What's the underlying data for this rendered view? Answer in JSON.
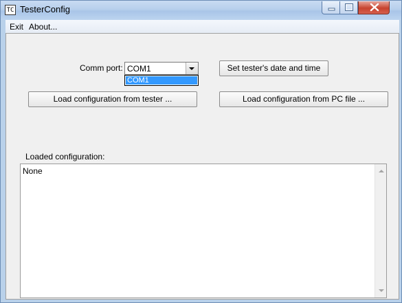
{
  "window": {
    "title": "TesterConfig",
    "icon_text": "TC"
  },
  "menu": {
    "items": [
      {
        "label": "Exit"
      },
      {
        "label": "About..."
      }
    ]
  },
  "form": {
    "comm_port_label": "Comm port:",
    "comm_port_value": "COM1",
    "comm_port_options": [
      "COM1"
    ],
    "set_datetime_button": "Set tester's date and time",
    "load_from_tester_button": "Load configuration from tester ...",
    "load_from_file_button": "Load configuration from PC file ...",
    "loaded_config_label": "Loaded configuration:",
    "loaded_config_text": "None"
  },
  "colors": {
    "selection": "#3399ff",
    "title_bar": "#b9d1ea",
    "close_button": "#c7432f"
  }
}
